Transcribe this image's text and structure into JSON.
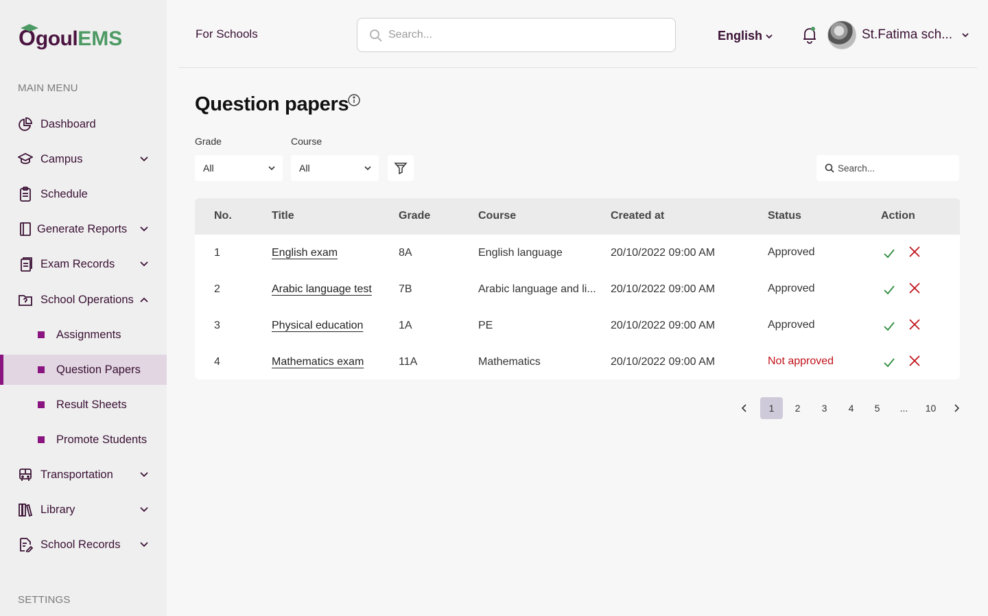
{
  "app": {
    "logo_first": "O",
    "logo_mid": "goul",
    "logo_accent": "EMS",
    "brand_color": "#3a1034",
    "accent_color": "#8a1480",
    "logo_green": "#4d9a64"
  },
  "sidebar": {
    "main_menu_label": "MAIN MENU",
    "settings_label": "SETTINGS",
    "items": [
      {
        "label": "Dashboard",
        "icon": "pie-chart-icon"
      },
      {
        "label": "Campus",
        "icon": "graduation-cap-icon"
      },
      {
        "label": "Schedule",
        "icon": "clipboard-icon"
      },
      {
        "label": "Generate Reports",
        "icon": "book-icon"
      },
      {
        "label": "Exam Records",
        "icon": "documents-icon"
      },
      {
        "label": "School Operations",
        "icon": "folder-icon"
      },
      {
        "label": "Transportation",
        "icon": "bus-icon"
      },
      {
        "label": "Library",
        "icon": "library-icon"
      },
      {
        "label": "School Records",
        "icon": "file-edit-icon"
      }
    ],
    "subitems": [
      {
        "label": "Assignments"
      },
      {
        "label": "Question Papers",
        "active": true
      },
      {
        "label": "Result Sheets"
      },
      {
        "label": "Promote Students"
      }
    ]
  },
  "header": {
    "for_schools": "For Schools",
    "search_placeholder": "Search...",
    "language": "English",
    "user_name": "St.Fatima sch..."
  },
  "page": {
    "title": "Question papers",
    "filters": {
      "grade_label": "Grade",
      "grade_value": "All",
      "course_label": "Course",
      "course_value": "All"
    },
    "table_search_placeholder": "Search..."
  },
  "table": {
    "columns": [
      "No.",
      "Title",
      "Grade",
      "Course",
      "Created at",
      "Status",
      "Action"
    ],
    "rows": [
      {
        "no": "1",
        "title": "English exam",
        "grade": "8A",
        "course": "English language",
        "created": "20/10/2022 09:00 AM",
        "status": "Approved",
        "approved": true
      },
      {
        "no": "2",
        "title": "Arabic language test",
        "grade": "7B",
        "course": "Arabic language and li...",
        "created": "20/10/2022 09:00 AM",
        "status": "Approved",
        "approved": true
      },
      {
        "no": "3",
        "title": "Physical education",
        "grade": "1A",
        "course": "PE",
        "created": "20/10/2022 09:00 AM",
        "status": "Approved",
        "approved": true
      },
      {
        "no": "4",
        "title": "Mathematics exam",
        "grade": "11A",
        "course": "Mathematics",
        "created": "20/10/2022 09:00 AM",
        "status": "Not approved",
        "approved": false
      }
    ],
    "approve_color": "#2e8b3e",
    "reject_color": "#c0121a",
    "not_approved_color": "#c0121a"
  },
  "pagination": {
    "pages": [
      "1",
      "2",
      "3",
      "4",
      "5",
      "...",
      "10"
    ],
    "current": "1"
  }
}
